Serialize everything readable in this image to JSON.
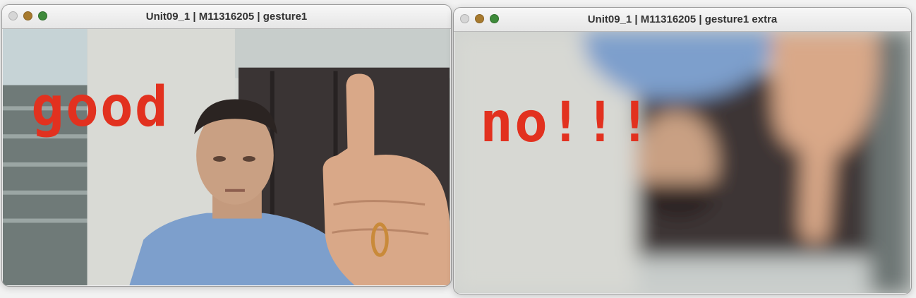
{
  "windows": [
    {
      "title": "Unit09_1 | M11316205 | gesture1",
      "overlay_text": "good",
      "overlay_color": "#e2311f"
    },
    {
      "title": "Unit09_1 | M11316205 | gesture1 extra",
      "overlay_text": "no!!!",
      "overlay_color": "#e2311f"
    }
  ],
  "traffic_lights": {
    "close_color": "#d6d6d6",
    "minimize_color": "#a77a2e",
    "zoom_color": "#3e8a3a"
  }
}
